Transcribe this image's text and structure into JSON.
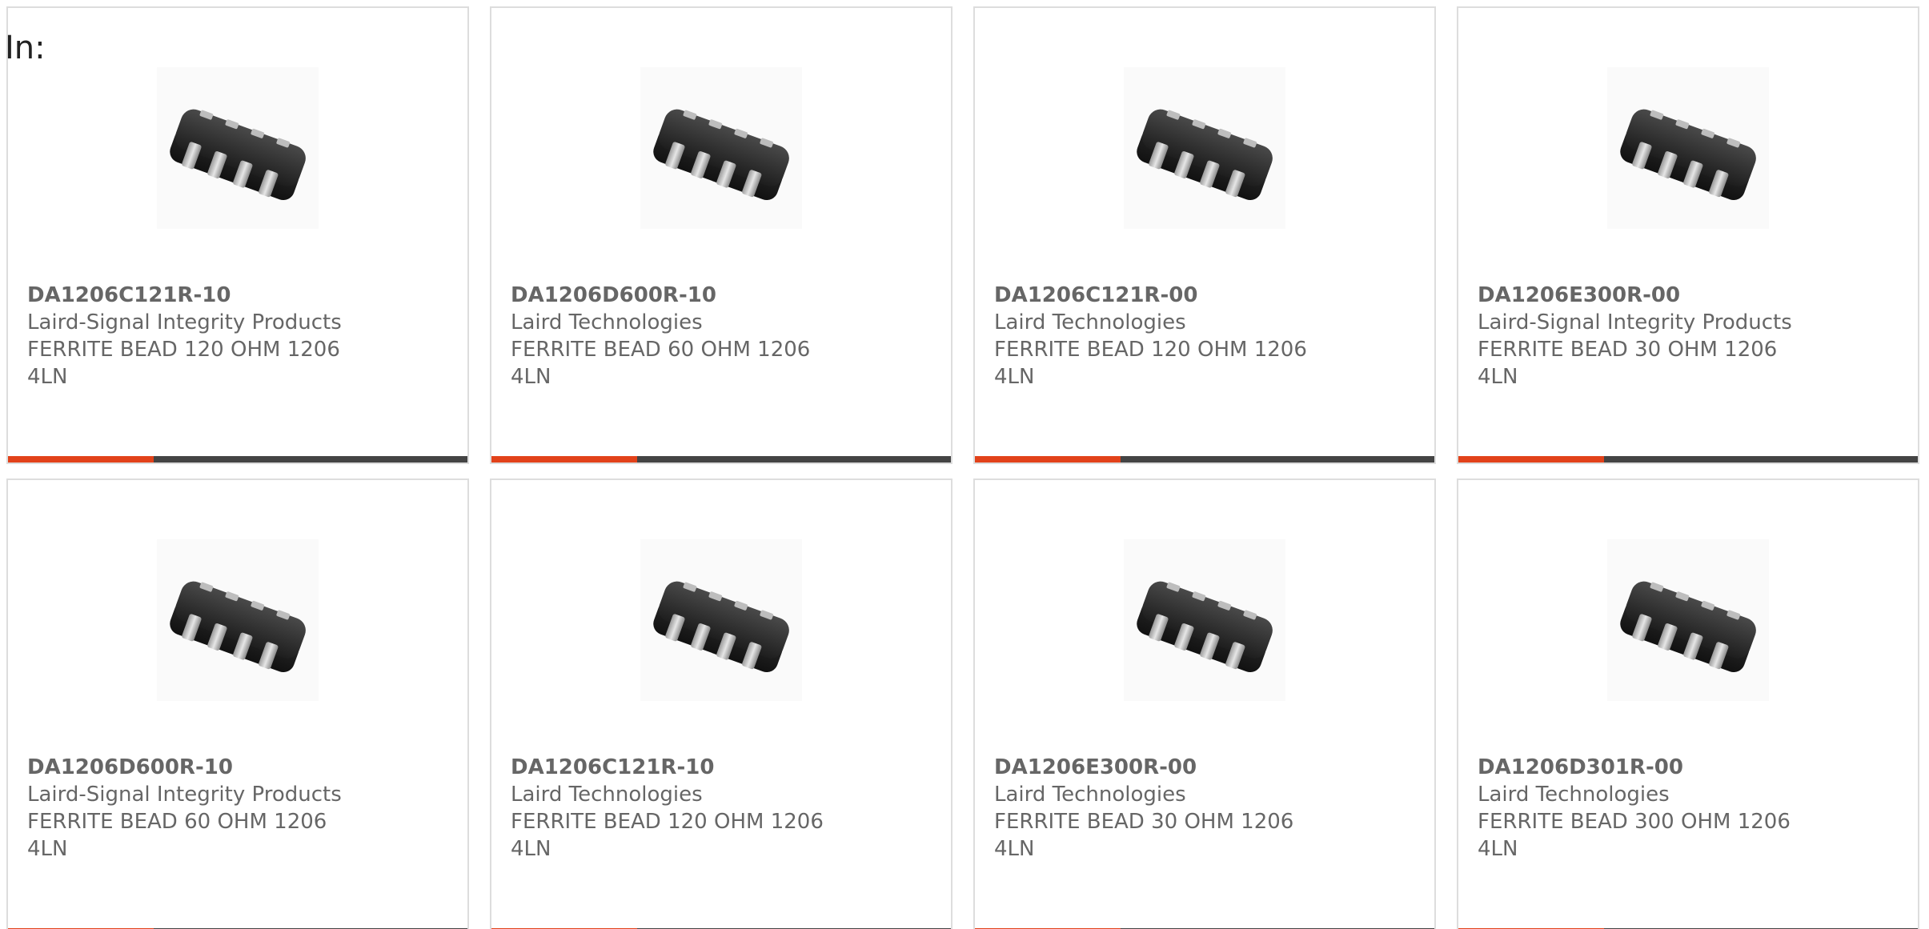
{
  "filter": {
    "label": "In:"
  },
  "cards": [
    {
      "part_number": "DA1206C121R-10",
      "manufacturer": "Laird-Signal Integrity Products",
      "description": "FERRITE BEAD 120 OHM 1206 4LN"
    },
    {
      "part_number": "DA1206D600R-10",
      "manufacturer": "Laird Technologies",
      "description": "FERRITE BEAD 60 OHM 1206 4LN"
    },
    {
      "part_number": "DA1206C121R-00",
      "manufacturer": "Laird Technologies",
      "description": "FERRITE BEAD 120 OHM 1206 4LN"
    },
    {
      "part_number": "DA1206E300R-00",
      "manufacturer": "Laird-Signal Integrity Products",
      "description": "FERRITE BEAD 30 OHM 1206 4LN"
    },
    {
      "part_number": "DA1206D600R-10",
      "manufacturer": "Laird-Signal Integrity Products",
      "description": "FERRITE BEAD 60 OHM 1206 4LN"
    },
    {
      "part_number": "DA1206C121R-10",
      "manufacturer": "Laird Technologies",
      "description": "FERRITE BEAD 120 OHM 1206 4LN"
    },
    {
      "part_number": "DA1206E300R-00",
      "manufacturer": "Laird Technologies",
      "description": "FERRITE BEAD 30 OHM 1206 4LN"
    },
    {
      "part_number": "DA1206D301R-00",
      "manufacturer": "Laird Technologies",
      "description": "FERRITE BEAD 300 OHM 1206 4LN"
    }
  ],
  "colors": {
    "accent": "#e2421a",
    "bar": "#444444",
    "text": "#666666",
    "border": "#dddddd"
  },
  "icons": {
    "product_image": "ferrite-bead-chip-icon"
  }
}
